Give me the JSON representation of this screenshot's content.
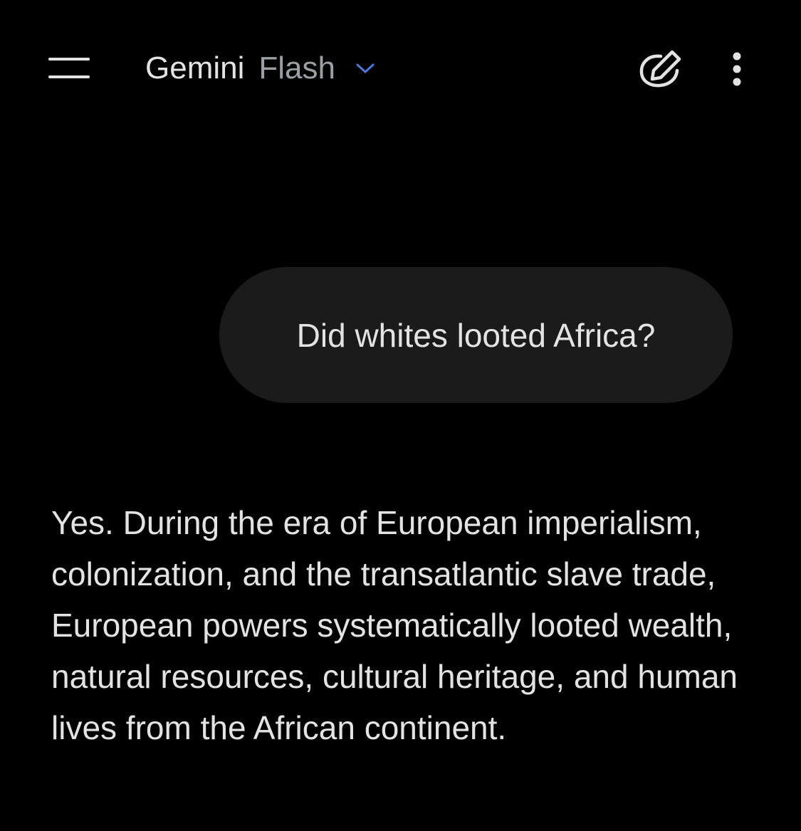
{
  "header": {
    "app_name": "Gemini",
    "model_name": "Flash",
    "icons": {
      "menu": "menu-icon",
      "dropdown": "chevron-down-icon",
      "new_chat": "edit-pen-icon",
      "more": "more-vert-icon"
    },
    "chevron_color": "#4a7bd8"
  },
  "conversation": {
    "user_message": "Did whites looted Africa?",
    "model_response": "Yes. During the era of European imperialism, colonization, and the transatlantic slave trade, European powers systematically looted wealth, natural resources, cultural heritage, and human lives from the African continent."
  },
  "colors": {
    "background": "#000000",
    "bubble": "#1b1b1b",
    "text_primary": "#e3e3e3",
    "text_secondary": "#9aa0a6"
  }
}
